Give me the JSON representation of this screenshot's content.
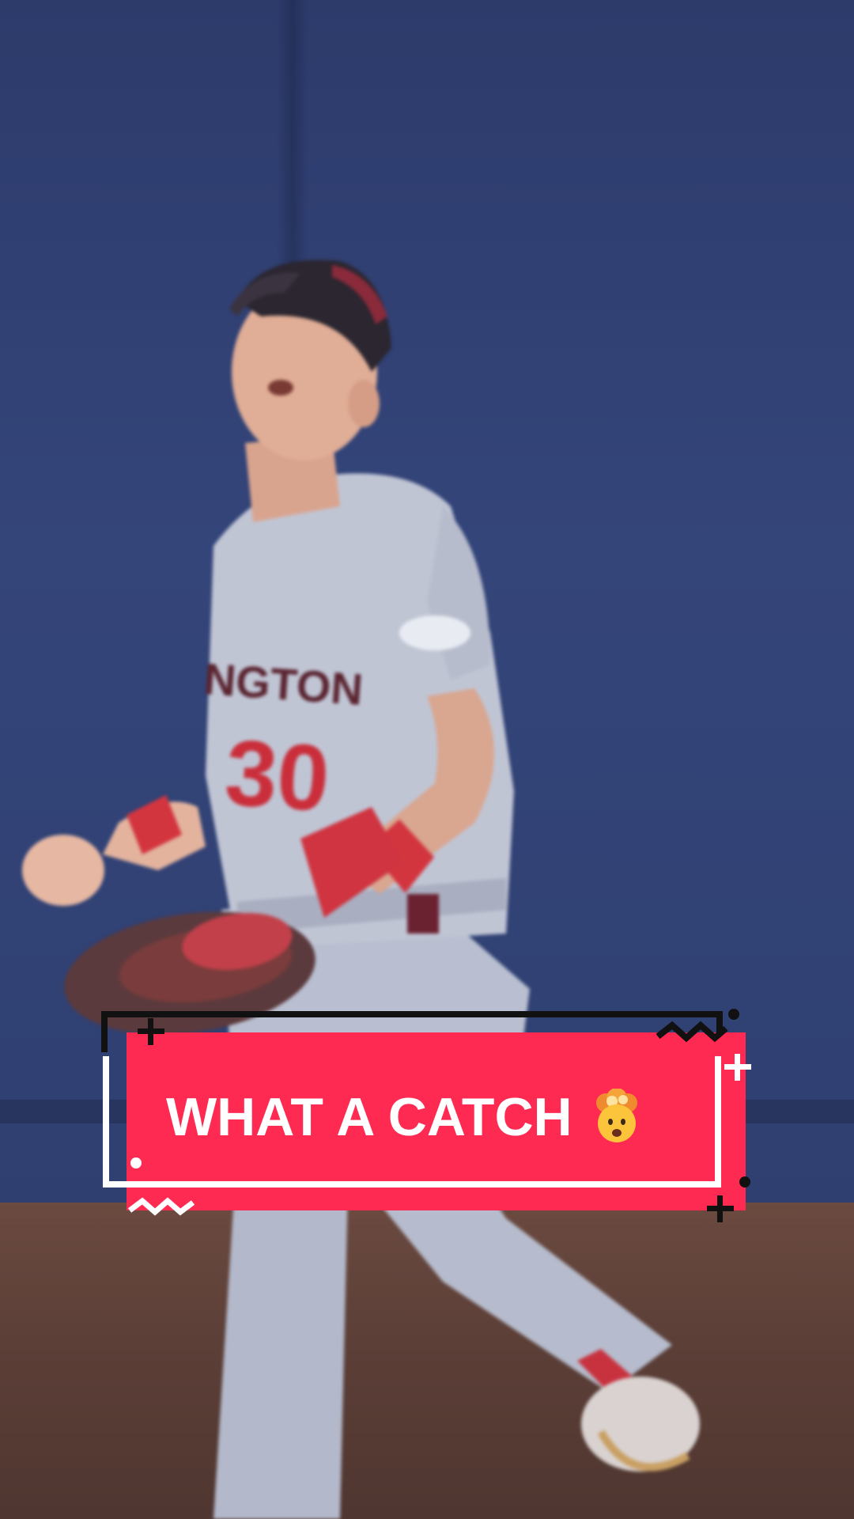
{
  "caption": {
    "text": "WHAT A CATCH",
    "emoji_name": "exploding-head-emoji",
    "box_color": "#ff2a52",
    "text_color": "#ffffff"
  },
  "scene": {
    "jersey_number": "30",
    "jersey_wordmark": "NGTON",
    "wall_color": "#2f3f70",
    "track_color": "#5d4038",
    "uniform_color": "#b9bfd0",
    "accent_red": "#d02a3c"
  }
}
